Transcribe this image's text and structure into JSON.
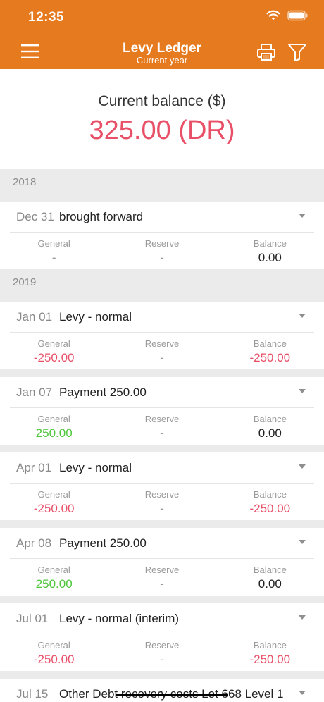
{
  "status": {
    "time": "12:35"
  },
  "header": {
    "title": "Levy Ledger",
    "subtitle": "Current year"
  },
  "balance": {
    "label": "Current balance ($)",
    "value": "325.00 (DR)"
  },
  "columns": {
    "general": "General",
    "reserve": "Reserve",
    "balance": "Balance"
  },
  "sections": [
    {
      "year": "2018",
      "entries": [
        {
          "date": "Dec 31",
          "desc": "brought forward",
          "general": "-",
          "reserve": "-",
          "balance": "0.00"
        }
      ]
    },
    {
      "year": "2019",
      "entries": [
        {
          "date": "Jan 01",
          "desc": "Levy - normal",
          "general": "-250.00",
          "reserve": "-",
          "balance": "-250.00"
        },
        {
          "date": "Jan 07",
          "desc": "Payment 250.00",
          "general": "250.00",
          "reserve": "-",
          "balance": "0.00"
        },
        {
          "date": "Apr 01",
          "desc": "Levy - normal",
          "general": "-250.00",
          "reserve": "-",
          "balance": "-250.00"
        },
        {
          "date": "Apr 08",
          "desc": "Payment 250.00",
          "general": "250.00",
          "reserve": "-",
          "balance": "0.00"
        },
        {
          "date": "Jul 01",
          "desc": "Levy - normal (interim)",
          "general": "-250.00",
          "reserve": "-",
          "balance": "-250.00"
        },
        {
          "date": "Jul 15",
          "desc": "Other Debt recovery costs Lot 668 Level 1"
        }
      ]
    }
  ],
  "colors": {
    "brand": "#e57a1f",
    "negative": "#e85068",
    "positive": "#4fc63c"
  },
  "icons": {
    "menu": "menu-icon",
    "print": "print-icon",
    "filter": "filter-icon",
    "caret": "chevron-down-icon"
  }
}
